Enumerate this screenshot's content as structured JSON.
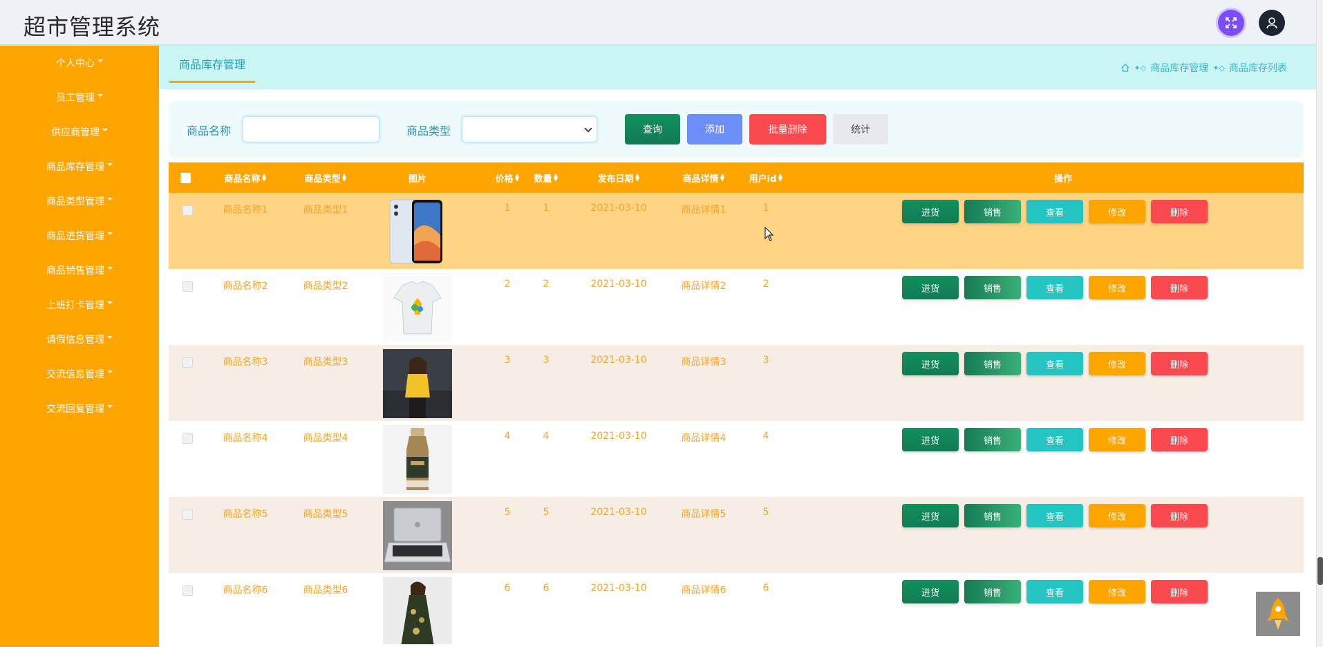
{
  "app": {
    "title": "超市管理系统"
  },
  "header": {
    "fullscreen_icon": "fullscreen-icon",
    "user_icon": "user-icon"
  },
  "sidebar": {
    "items": [
      {
        "label": "个人中心"
      },
      {
        "label": "员工管理"
      },
      {
        "label": "供应商管理"
      },
      {
        "label": "商品库存管理"
      },
      {
        "label": "商品类型管理"
      },
      {
        "label": "商品进货管理"
      },
      {
        "label": "商品销售管理"
      },
      {
        "label": "上班打卡管理"
      },
      {
        "label": "请假信息管理"
      },
      {
        "label": "交流信息管理"
      },
      {
        "label": "交流回复管理"
      }
    ]
  },
  "breadcrumb": {
    "tab": "商品库存管理",
    "crumbs": [
      "商品库存管理",
      "商品库存列表"
    ]
  },
  "search": {
    "name_label": "商品名称",
    "name_value": "",
    "type_label": "商品类型",
    "type_value": "",
    "query_label": "查询",
    "add_label": "添加",
    "batch_delete_label": "批量删除",
    "stats_label": "统计"
  },
  "table": {
    "columns": [
      "商品名称",
      "商品类型",
      "图片",
      "价格",
      "数量",
      "发布日期",
      "商品详情",
      "用户id",
      "操作"
    ],
    "actions": {
      "in": "进货",
      "sell": "销售",
      "view": "查看",
      "edit": "修改",
      "delete": "删除"
    },
    "rows": [
      {
        "name": "商品名称1",
        "type": "商品类型1",
        "image": "phone",
        "price": "1",
        "qty": "1",
        "date": "2021-03-10",
        "detail": "商品详情1",
        "userid": "1"
      },
      {
        "name": "商品名称2",
        "type": "商品类型2",
        "image": "tshirt",
        "price": "2",
        "qty": "2",
        "date": "2021-03-10",
        "detail": "商品详情2",
        "userid": "2"
      },
      {
        "name": "商品名称3",
        "type": "商品类型3",
        "image": "woman-yellow",
        "price": "3",
        "qty": "3",
        "date": "2021-03-10",
        "detail": "商品详情3",
        "userid": "3"
      },
      {
        "name": "商品名称4",
        "type": "商品类型4",
        "image": "bottle",
        "price": "4",
        "qty": "4",
        "date": "2021-03-10",
        "detail": "商品详情4",
        "userid": "4"
      },
      {
        "name": "商品名称5",
        "type": "商品类型5",
        "image": "laptop",
        "price": "5",
        "qty": "5",
        "date": "2021-03-10",
        "detail": "商品详情5",
        "userid": "5"
      },
      {
        "name": "商品名称6",
        "type": "商品类型6",
        "image": "woman-dress",
        "price": "6",
        "qty": "6",
        "date": "2021-03-10",
        "detail": "商品详情6",
        "userid": "6"
      }
    ]
  },
  "colors": {
    "sidebar": "#ffa500",
    "accent": "#20a4b0",
    "danger": "#fb4a4f",
    "primary": "#6c8ef7"
  }
}
